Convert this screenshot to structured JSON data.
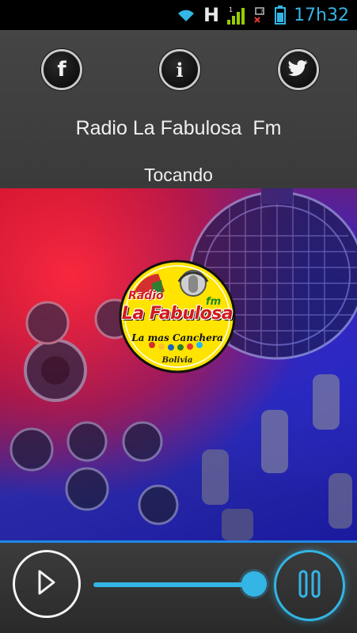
{
  "status_bar": {
    "time": "17h32",
    "network_type": "H",
    "icons": [
      "wifi-icon",
      "signal-icon",
      "sim-no-signal-icon",
      "battery-icon"
    ],
    "accent_color": "#33b5e5"
  },
  "header": {
    "station_name": "Radio La Fabulosa  Fm",
    "playing_label": "Tocando",
    "buttons": [
      {
        "name": "facebook-button",
        "glyph": "f",
        "icon": "facebook-icon"
      },
      {
        "name": "info-button",
        "glyph": "i",
        "icon": "info-icon"
      },
      {
        "name": "twitter-button",
        "glyph": "",
        "icon": "twitter-bird-icon"
      }
    ]
  },
  "logo": {
    "radio": "Radio",
    "title": "La Fabulosa",
    "fm": "fm",
    "slogan": "La mas Canchera",
    "country": "Bolivia"
  },
  "player": {
    "progress": 0.9,
    "accent_color": "#33b5e5",
    "play_icon": "play-icon",
    "pause_icon": "pause-icon"
  }
}
